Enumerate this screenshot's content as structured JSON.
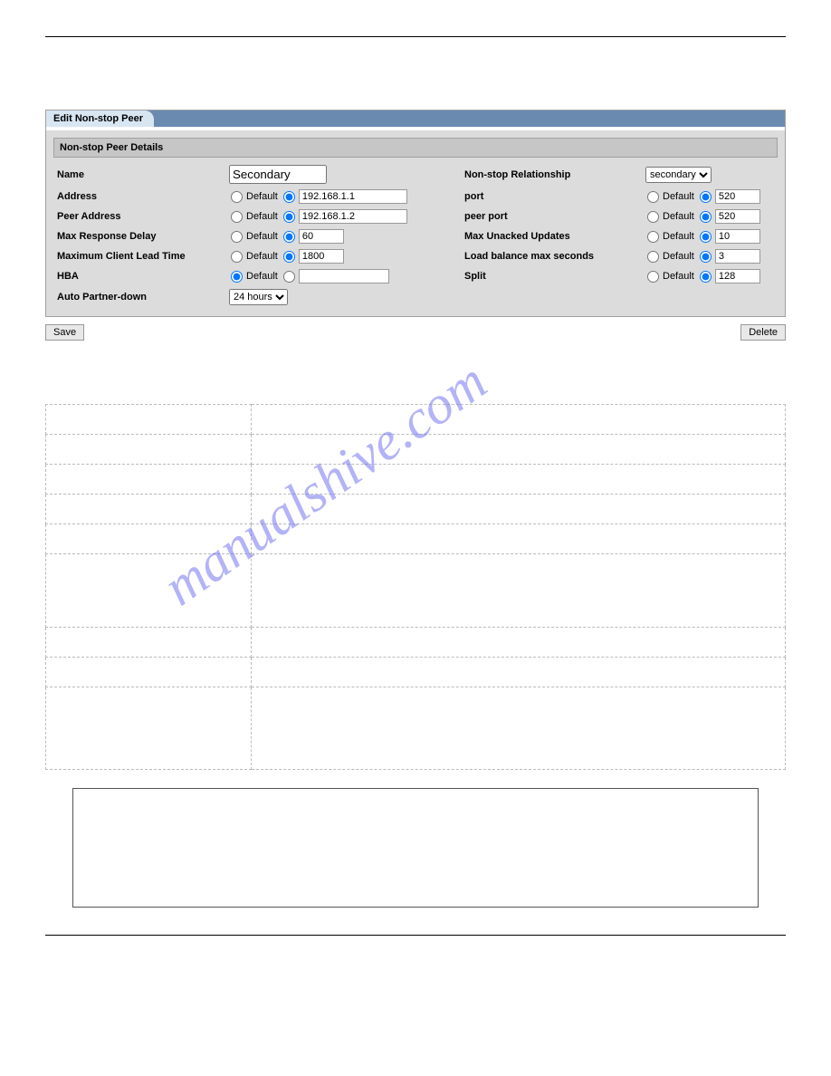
{
  "tab_label": "Edit Non-stop Peer",
  "section_title": "Non-stop Peer Details",
  "default_label": "Default",
  "buttons": {
    "save": "Save",
    "delete": "Delete"
  },
  "fields": {
    "name": {
      "label": "Name",
      "value": "Secondary"
    },
    "relationship": {
      "label": "Non-stop Relationship",
      "value": "secondary"
    },
    "address": {
      "label": "Address",
      "value": "192.168.1.1"
    },
    "port": {
      "label": "port",
      "value": "520"
    },
    "peer_address": {
      "label": "Peer Address",
      "value": "192.168.1.2"
    },
    "peer_port": {
      "label": "peer port",
      "value": "520"
    },
    "max_response_delay": {
      "label": "Max Response Delay",
      "value": "60"
    },
    "max_unacked_updates": {
      "label": "Max Unacked Updates",
      "value": "10"
    },
    "max_client_lead_time": {
      "label": "Maximum Client Lead Time",
      "value": "1800"
    },
    "load_balance_max_seconds": {
      "label": "Load balance max seconds",
      "value": "3"
    },
    "hba": {
      "label": "HBA",
      "value": ""
    },
    "split": {
      "label": "Split",
      "value": "128"
    },
    "auto_partner_down": {
      "label": "Auto Partner-down",
      "value": "24 hours"
    }
  },
  "watermark": "manualshive.com"
}
